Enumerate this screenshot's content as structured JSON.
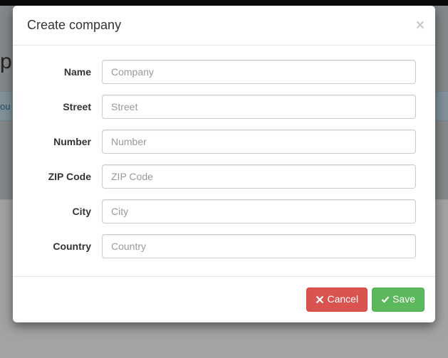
{
  "modal": {
    "title": "Create company",
    "close": "×"
  },
  "background": {
    "partial_heading": "pa",
    "partial_alert": "ou"
  },
  "form": {
    "fields": [
      {
        "label": "Name",
        "placeholder": "Company",
        "value": ""
      },
      {
        "label": "Street",
        "placeholder": "Street",
        "value": ""
      },
      {
        "label": "Number",
        "placeholder": "Number",
        "value": ""
      },
      {
        "label": "ZIP Code",
        "placeholder": "ZIP Code",
        "value": ""
      },
      {
        "label": "City",
        "placeholder": "City",
        "value": ""
      },
      {
        "label": "Country",
        "placeholder": "Country",
        "value": ""
      }
    ]
  },
  "buttons": {
    "cancel": "Cancel",
    "save": "Save"
  }
}
